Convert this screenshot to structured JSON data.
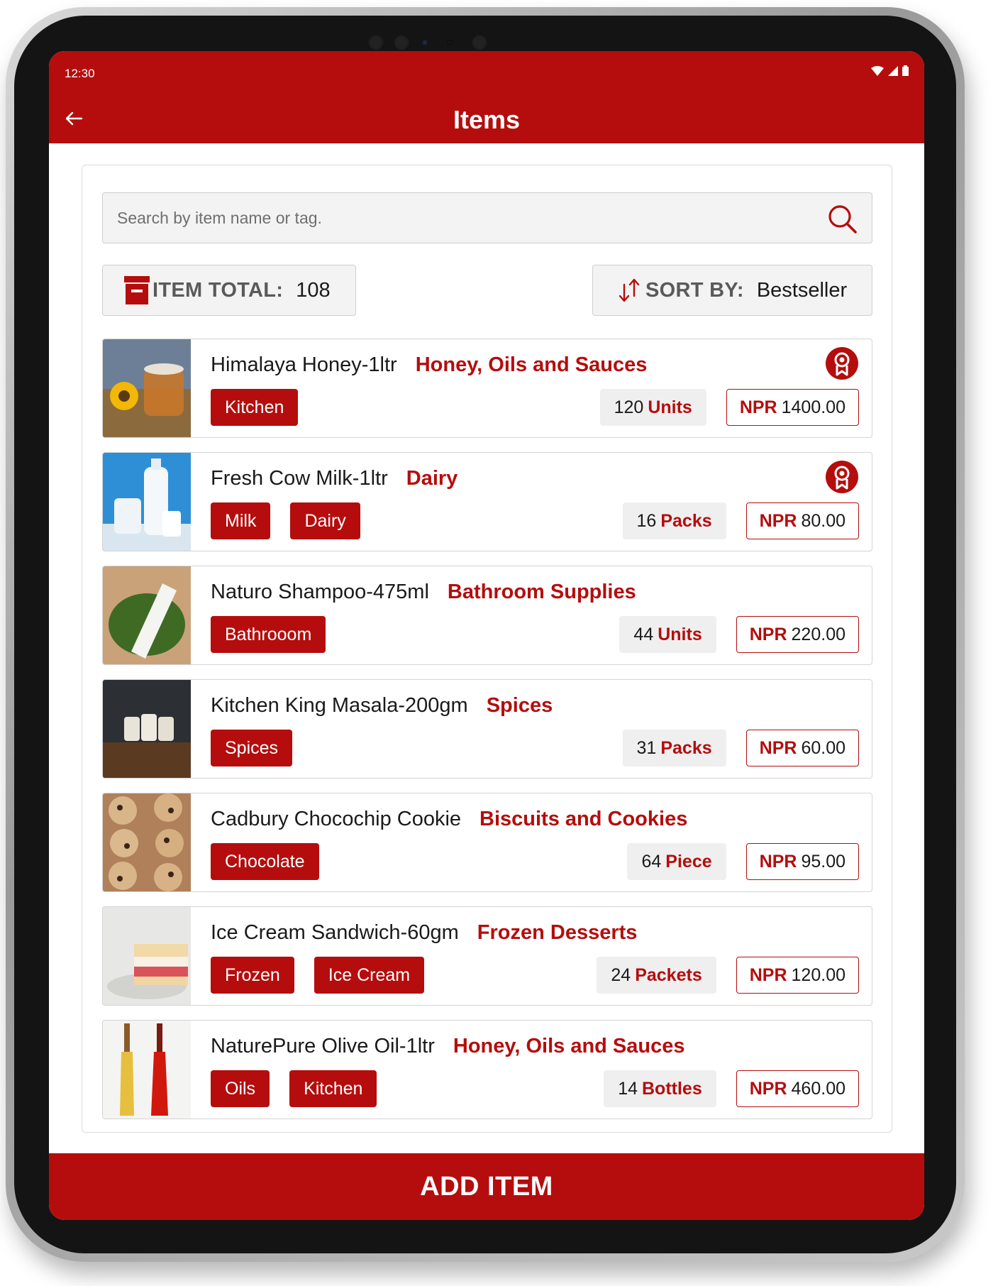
{
  "status_bar": {
    "time": "12:30",
    "icons": [
      "wifi-icon",
      "signal-icon",
      "battery-icon"
    ]
  },
  "header": {
    "title": "Items",
    "back_icon": "arrow-left-icon"
  },
  "search": {
    "placeholder": "Search by item name or tag.",
    "value": "",
    "icon": "search-icon"
  },
  "item_total": {
    "label": "ITEM TOTAL:",
    "value": "108",
    "icon": "archive-box-icon"
  },
  "sort": {
    "label": "SORT BY:",
    "value": "Bestseller",
    "icon": "sort-arrows-icon"
  },
  "colors": {
    "brand": "#b50d0d",
    "surface": "#f3f3f3",
    "border": "#cfcfcf"
  },
  "items": [
    {
      "name": "Himalaya Honey-1ltr",
      "category": "Honey, Oils and Sauces",
      "tags": [
        "Kitchen"
      ],
      "qty": "120",
      "unit": "Units",
      "currency": "NPR",
      "price": "1400.00",
      "bestseller": true,
      "image": "honey-jar"
    },
    {
      "name": "Fresh Cow Milk-1ltr",
      "category": "Dairy",
      "tags": [
        "Milk",
        "Dairy"
      ],
      "qty": "16",
      "unit": "Packs",
      "currency": "NPR",
      "price": "80.00",
      "bestseller": true,
      "image": "milk-bottles"
    },
    {
      "name": "Naturo Shampoo-475ml",
      "category": "Bathroom Supplies",
      "tags": [
        "Bathrooom"
      ],
      "qty": "44",
      "unit": "Units",
      "currency": "NPR",
      "price": "220.00",
      "bestseller": false,
      "image": "shampoo-tube"
    },
    {
      "name": "Kitchen King Masala-200gm",
      "category": "Spices",
      "tags": [
        "Spices"
      ],
      "qty": "31",
      "unit": "Packs",
      "currency": "NPR",
      "price": "60.00",
      "bestseller": false,
      "image": "spice-jars"
    },
    {
      "name": "Cadbury Chocochip Cookie",
      "category": "Biscuits and Cookies",
      "tags": [
        "Chocolate"
      ],
      "qty": "64",
      "unit": "Piece",
      "currency": "NPR",
      "price": "95.00",
      "bestseller": false,
      "image": "cookies"
    },
    {
      "name": "Ice Cream Sandwich-60gm",
      "category": "Frozen Desserts",
      "tags": [
        "Frozen",
        "Ice Cream"
      ],
      "qty": "24",
      "unit": "Packets",
      "currency": "NPR",
      "price": "120.00",
      "bestseller": false,
      "image": "ice-cream-sandwich"
    },
    {
      "name": "NaturePure Olive Oil-1ltr",
      "category": "Honey, Oils and Sauces",
      "tags": [
        "Oils",
        "Kitchen"
      ],
      "qty": "14",
      "unit": "Bottles",
      "currency": "NPR",
      "price": "460.00",
      "bestseller": false,
      "image": "oil-bottles"
    }
  ],
  "footer": {
    "add_label": "ADD ITEM"
  }
}
